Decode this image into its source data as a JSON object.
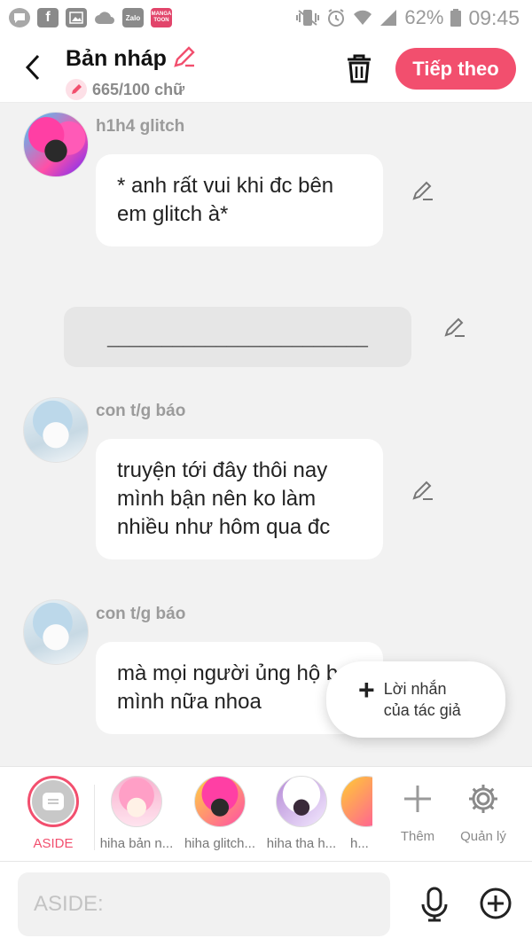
{
  "status_bar": {
    "battery": "62%",
    "time": "09:45",
    "left_icons": [
      "chat-bubble-icon",
      "facebook-icon",
      "image-icon",
      "cloud-icon",
      "zalo-icon",
      "mangatoon-icon"
    ],
    "zalo_text": "Zalo",
    "manga_text": "MANGA TOON"
  },
  "header": {
    "title": "Bản nháp",
    "word_count": "665/100 chữ",
    "next_label": "Tiếp theo"
  },
  "messages": [
    {
      "sender": "h1h4 glitch",
      "text": "* anh rất vui khi đc bên em glitch à*",
      "avatar": "glitch"
    },
    {
      "type": "narration",
      "text": "________________________"
    },
    {
      "sender": "con t/g báo",
      "text": "truyện tới đây thôi nay mình bận nên ko làm nhiều như hôm qua đc",
      "avatar": "pale"
    },
    {
      "sender": "con t/g báo",
      "text": "mà mọi người ủng hộ bạn mình nữa nhoa",
      "avatar": "pale"
    }
  ],
  "author_note": {
    "label_line1": "Lời nhắn",
    "label_line2": "của tác giả"
  },
  "characters": [
    {
      "label": "ASIDE",
      "selected": true
    },
    {
      "label": "hiha bản n..."
    },
    {
      "label": "hiha glitch..."
    },
    {
      "label": "hiha tha h..."
    },
    {
      "label": "h..."
    }
  ],
  "tools": {
    "add_label": "Thêm",
    "manage_label": "Quản lý"
  },
  "composer": {
    "placeholder": "ASIDE:"
  },
  "colors": {
    "accent": "#f24f6e",
    "background": "#f2f2f2",
    "bubble": "#ffffff"
  }
}
